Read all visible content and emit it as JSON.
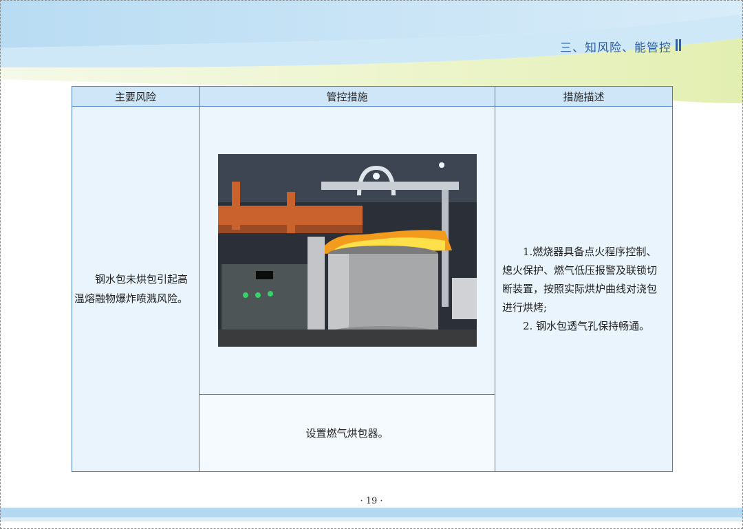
{
  "header": {
    "section_title": "三、知风险、能管控"
  },
  "table": {
    "headers": [
      "主要风险",
      "管控措施",
      "措施描述"
    ],
    "risk": "钢水包未烘包引起高温熔融物爆炸喷溅风险。",
    "measure": "设置燃气烘包器。",
    "description": [
      "1.燃烧器具备点火程序控制、熄火保护、燃气低压报警及联锁切断装置，按照实际烘炉曲线对浇包进行烘烤;",
      "2. 钢水包透气孔保持畅通。"
    ]
  },
  "photo": {
    "icon": "ladle-baking-photo"
  },
  "footer": {
    "page_number": "· 19 ·"
  }
}
